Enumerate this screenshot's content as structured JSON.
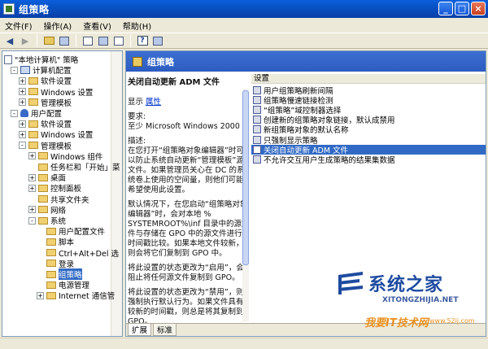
{
  "window": {
    "title": "组策略",
    "min": "_",
    "max": "□",
    "close": "×"
  },
  "menu": [
    "文件(F)",
    "操作(A)",
    "查看(V)",
    "帮助(H)"
  ],
  "tree": {
    "items": [
      {
        "label": "\"本地计算机\" 策略",
        "level": 0,
        "icon": "doc",
        "exp": ""
      },
      {
        "label": "计算机配置",
        "level": 1,
        "icon": "comp",
        "exp": "-"
      },
      {
        "label": "软件设置",
        "level": 2,
        "icon": "fold",
        "exp": "+"
      },
      {
        "label": "Windows 设置",
        "level": 2,
        "icon": "fold",
        "exp": "+"
      },
      {
        "label": "管理模板",
        "level": 2,
        "icon": "fold",
        "exp": "+"
      },
      {
        "label": "用户配置",
        "level": 1,
        "icon": "user",
        "exp": "-"
      },
      {
        "label": "软件设置",
        "level": 2,
        "icon": "fold",
        "exp": "+"
      },
      {
        "label": "Windows 设置",
        "level": 2,
        "icon": "fold",
        "exp": "+"
      },
      {
        "label": "管理模板",
        "level": 2,
        "icon": "fold",
        "exp": "-"
      },
      {
        "label": "Windows 组件",
        "level": 3,
        "icon": "fold",
        "exp": "+"
      },
      {
        "label": "任务栏和「开始」菜",
        "level": 3,
        "icon": "fold",
        "exp": ""
      },
      {
        "label": "桌面",
        "level": 3,
        "icon": "fold",
        "exp": "+"
      },
      {
        "label": "控制面板",
        "level": 3,
        "icon": "fold",
        "exp": "+"
      },
      {
        "label": "共享文件夹",
        "level": 3,
        "icon": "fold",
        "exp": ""
      },
      {
        "label": "网络",
        "level": 3,
        "icon": "fold",
        "exp": "+"
      },
      {
        "label": "系统",
        "level": 3,
        "icon": "fold",
        "exp": "-"
      },
      {
        "label": "用户配置文件",
        "level": 4,
        "icon": "fold",
        "exp": ""
      },
      {
        "label": "脚本",
        "level": 4,
        "icon": "fold",
        "exp": ""
      },
      {
        "label": "Ctrl+Alt+Del 选",
        "level": 4,
        "icon": "fold",
        "exp": ""
      },
      {
        "label": "登录",
        "level": 4,
        "icon": "fold",
        "exp": ""
      },
      {
        "label": "组策略",
        "level": 4,
        "icon": "fold",
        "exp": "",
        "selected": true
      },
      {
        "label": "电源管理",
        "level": 4,
        "icon": "fold",
        "exp": ""
      },
      {
        "label": "Internet 通信管",
        "level": 4,
        "icon": "fold",
        "exp": "+"
      }
    ]
  },
  "right": {
    "header": "组策略",
    "policy_title": "关闭自动更新 ADM 文件",
    "display_label": "显示",
    "display_link": "属性",
    "requires_label": "要求:",
    "requires_value": "至少 Microsoft Windows 2000",
    "desc_label": "描述:",
    "desc_p1": "在您打开“组策略对象编辑器”时可以防止系统自动更新“管理模板”源文件。如果管理员关心在 DC 的系统卷上使用的空间量，则他们可能希望使用此设置。",
    "desc_p2": "默认情况下，在您启动“组策略对象编辑器”时，会对本地 % SYSTEMROOT%\\inf 目录中的源文件与存储在 GPO 中的源文件进行时间戳比较。如果本地文件较新，则会将它们复制到 GPO 中。",
    "desc_p3": "将此设置的状态更改为“启用”，会阻止将任何源文件复制到 GPO。",
    "desc_p4": "将此设置的状态更改为“禁用”，则强制执行默认行为。如果文件具有较新的时间戳，则总是将其复制到 GPO。",
    "list_header": "设置",
    "list_items": [
      "用户组策略刷新间隔",
      "组策略慢速链接检测",
      "“组策略”域控制器选择",
      "创建新的组策略对象链接，默认成禁用",
      "新组策略对象的默认名称",
      "只强制显示策略",
      "关闭自动更新 ADM 文件",
      "不允许交互用户生成策略的结果集数据"
    ],
    "selected_index": 6,
    "tabs": [
      "扩展",
      "标准"
    ]
  },
  "watermark": {
    "title": "系统之家",
    "sub": "XITONGZHIJIA.NET",
    "slogan": "我要IT技术网",
    "url": "www.52ij.com"
  }
}
